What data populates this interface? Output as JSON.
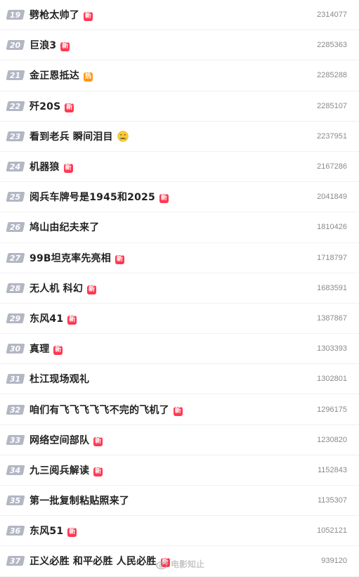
{
  "items": [
    {
      "rank": "19",
      "title": "劈枪太帅了",
      "tag": "新",
      "tag_type": "new",
      "count": "2314077"
    },
    {
      "rank": "20",
      "title": "巨浪3",
      "tag": "新",
      "tag_type": "new",
      "count": "2285363"
    },
    {
      "rank": "21",
      "title": "金正恩抵达",
      "tag": "热",
      "tag_type": "hot",
      "count": "2285288"
    },
    {
      "rank": "22",
      "title": "歼20S",
      "tag": "新",
      "tag_type": "new",
      "count": "2285107"
    },
    {
      "rank": "23",
      "title": "看到老兵 瞬间泪目",
      "tag": "",
      "tag_type": "emoji",
      "emoji": "crying-face-icon",
      "count": "2237951"
    },
    {
      "rank": "24",
      "title": "机器狼",
      "tag": "新",
      "tag_type": "new",
      "count": "2167286"
    },
    {
      "rank": "25",
      "title": "阅兵车牌号是1945和2025",
      "tag": "新",
      "tag_type": "new",
      "count": "2041849"
    },
    {
      "rank": "26",
      "title": "鸠山由纪夫来了",
      "tag": "",
      "tag_type": "none",
      "count": "1810426"
    },
    {
      "rank": "27",
      "title": "99B坦克率先亮相",
      "tag": "新",
      "tag_type": "new",
      "count": "1718797"
    },
    {
      "rank": "28",
      "title": "无人机 科幻",
      "tag": "新",
      "tag_type": "new",
      "count": "1683591"
    },
    {
      "rank": "29",
      "title": "东风41",
      "tag": "新",
      "tag_type": "new",
      "count": "1387867"
    },
    {
      "rank": "30",
      "title": "真理",
      "tag": "新",
      "tag_type": "new",
      "count": "1303393"
    },
    {
      "rank": "31",
      "title": "杜江现场观礼",
      "tag": "",
      "tag_type": "none",
      "count": "1302801"
    },
    {
      "rank": "32",
      "title": "咱们有飞飞飞飞飞不完的飞机了",
      "tag": "新",
      "tag_type": "new",
      "count": "1296175"
    },
    {
      "rank": "33",
      "title": "网络空间部队",
      "tag": "新",
      "tag_type": "new",
      "count": "1230820"
    },
    {
      "rank": "34",
      "title": "九三阅兵解读",
      "tag": "新",
      "tag_type": "new",
      "count": "1152843"
    },
    {
      "rank": "35",
      "title": "第一批复制粘贴照来了",
      "tag": "",
      "tag_type": "none",
      "count": "1135307"
    },
    {
      "rank": "36",
      "title": "东风51",
      "tag": "新",
      "tag_type": "new",
      "count": "1052121"
    },
    {
      "rank": "37",
      "title": "正义必胜 和平必胜 人民必胜",
      "tag": "新",
      "tag_type": "new",
      "count": "939120"
    }
  ],
  "watermark": {
    "text": "电影知止",
    "icon": "weibo-icon"
  },
  "colors": {
    "new_tag": "#ff3852",
    "hot_tag": "#ff9812",
    "rank_badge": "#b3b7c4"
  }
}
